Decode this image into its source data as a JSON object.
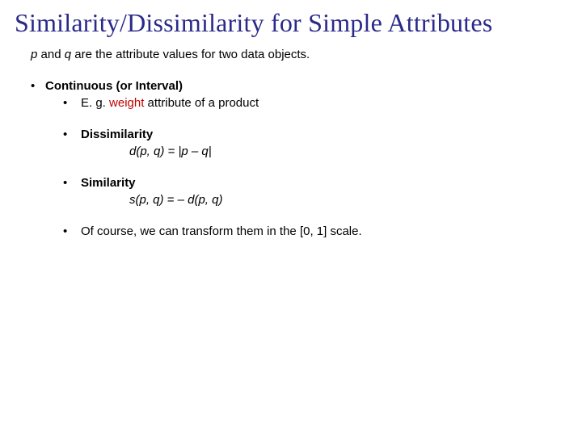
{
  "title": "Similarity/Dissimilarity for Simple Attributes",
  "subtitle": {
    "p": "p",
    "and": " and ",
    "q": "q",
    "rest": " are the attribute values for two data objects."
  },
  "bullets": {
    "main": "Continuous (or Interval)",
    "eg_prefix": "E. g. ",
    "eg_red": "weight",
    "eg_suffix": " attribute of a product",
    "dissim_label": "Dissimilarity",
    "dissim_formula": "d(p, q) = |p – q|",
    "sim_label": "Similarity",
    "sim_formula": "s(p, q) = – d(p, q)",
    "transform": "Of course, we can transform them in the [0, 1] scale."
  },
  "dot": "•"
}
